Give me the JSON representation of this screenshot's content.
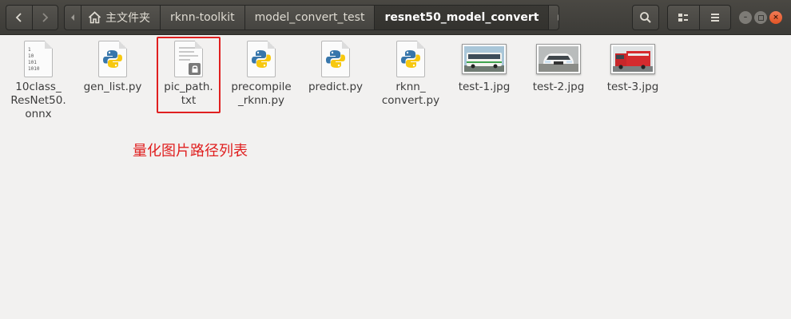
{
  "window": {
    "breadcrumbs": [
      {
        "label": "主文件夹",
        "icon": "home-icon"
      },
      {
        "label": "rknn-toolkit"
      },
      {
        "label": "model_convert_test"
      },
      {
        "label": "resnet50_model_convert",
        "active": true
      }
    ],
    "nav": {
      "back_icon": "chevron-left-icon",
      "forward_icon": "chevron-right-icon"
    },
    "toolbar": {
      "search_icon": "search-icon",
      "view_icon": "view-options-icon",
      "menu_icon": "hamburger-menu-icon"
    }
  },
  "files": [
    {
      "name": "10class_\nResNet50.\nonnx",
      "type": "binary",
      "icon": "binary-file-icon",
      "binary_digits": [
        "1",
        "10",
        "101",
        "1010"
      ]
    },
    {
      "name": "gen_list.py",
      "type": "python",
      "icon": "python-file-icon"
    },
    {
      "name": "pic_path.\ntxt",
      "type": "text-locked",
      "icon": "locked-text-file-icon"
    },
    {
      "name": "precompile\n_rknn.py",
      "type": "python",
      "icon": "python-file-icon"
    },
    {
      "name": "predict.py",
      "type": "python",
      "icon": "python-file-icon"
    },
    {
      "name": "rknn_\nconvert.py",
      "type": "python",
      "icon": "python-file-icon"
    },
    {
      "name": "test-1.jpg",
      "type": "image",
      "icon": "bus-thumbnail"
    },
    {
      "name": "test-2.jpg",
      "type": "image",
      "icon": "car-thumbnail"
    },
    {
      "name": "test-3.jpg",
      "type": "image",
      "icon": "firetruck-thumbnail"
    }
  ],
  "annotation": {
    "text": "量化图片路径列表",
    "color": "#e02020"
  },
  "colors": {
    "header": "#3c3b37",
    "background": "#f2f1f0",
    "close_button": "#e25525"
  }
}
